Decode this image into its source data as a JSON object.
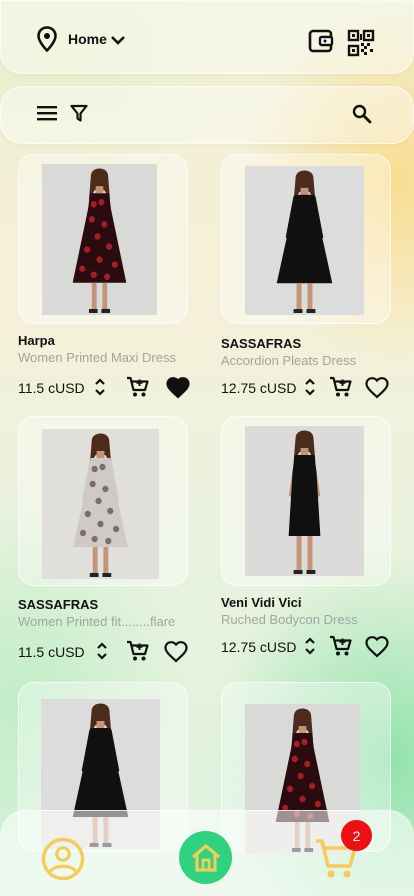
{
  "header": {
    "location_label": "Home",
    "icons": [
      "location-pin-icon",
      "chevron-down-icon",
      "wallet-icon",
      "qr-code-icon"
    ]
  },
  "toolbar": {
    "icons": [
      "menu-icon",
      "filter-icon",
      "search-icon"
    ]
  },
  "products": [
    {
      "brand": "Harpa",
      "name": "Women Printed Maxi Dress",
      "price": "11.5 cUSD",
      "wishlisted": true,
      "dress": "floral-red"
    },
    {
      "brand": "SASSAFRAS",
      "name": "Accordion Pleats Dress",
      "price": "12.75 cUSD",
      "wishlisted": false,
      "dress": "black-long-sleeve"
    },
    {
      "brand": "SASSAFRAS",
      "name": "Women Printed fit........flare",
      "price": "11.5 cUSD",
      "wishlisted": false,
      "dress": "print-white"
    },
    {
      "brand": "Veni Vidi Vici",
      "name": "Ruched Bodycon Dress",
      "price": "12.75 cUSD",
      "wishlisted": false,
      "dress": "black-bodycon"
    },
    {
      "brand": "",
      "name": "",
      "price": "",
      "wishlisted": false,
      "dress": "black-long-sleeve"
    },
    {
      "brand": "",
      "name": "",
      "price": "",
      "wishlisted": false,
      "dress": "floral-red"
    }
  ],
  "bottom_nav": {
    "cart_count": "2",
    "icons": [
      "profile-icon",
      "home-icon",
      "cart-icon"
    ],
    "colors": {
      "home_bg": "#2ed27f",
      "accent": "#f3cc5a",
      "badge": "#ee1111"
    }
  }
}
